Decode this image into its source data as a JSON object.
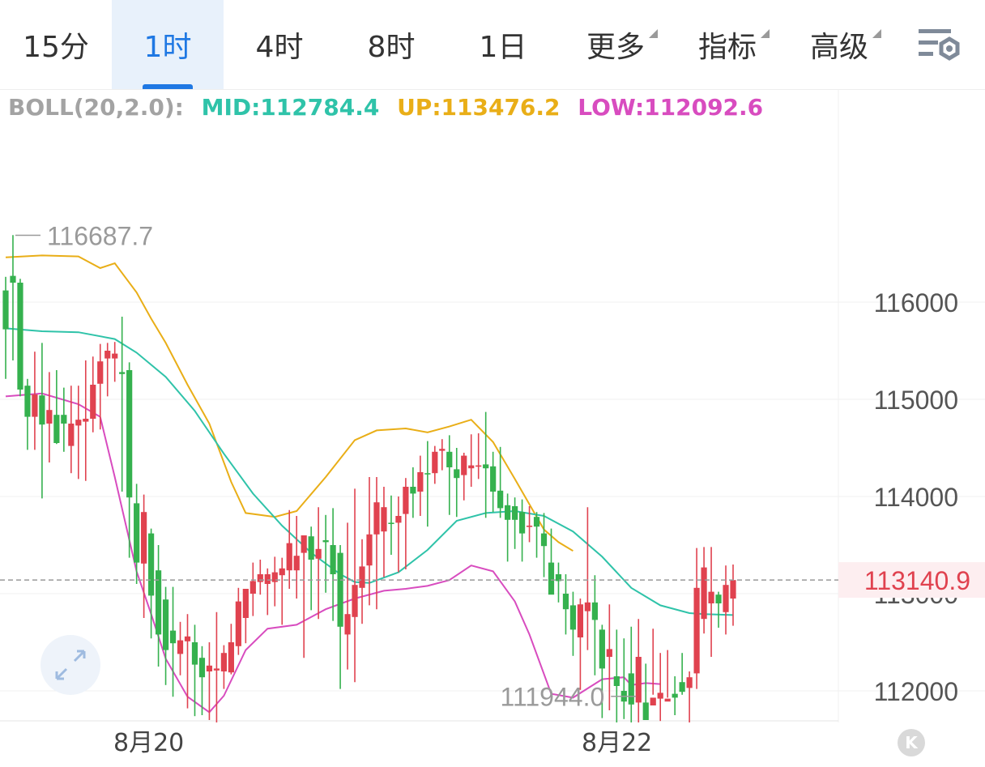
{
  "tabs": [
    {
      "label": "15分",
      "active": false
    },
    {
      "label": "1时",
      "active": true
    },
    {
      "label": "4时",
      "active": false
    },
    {
      "label": "8时",
      "active": false
    },
    {
      "label": "1日",
      "active": false
    },
    {
      "label": "更多",
      "active": false,
      "dropdown": true
    },
    {
      "label": "指标",
      "active": false,
      "dropdown": true
    },
    {
      "label": "高级",
      "active": false,
      "dropdown": true
    }
  ],
  "settings_icon": "chart-settings-icon",
  "expand_icon": "expand-arrows-icon",
  "k_button_label": "K",
  "boll": {
    "name": "BOLL(20,2.0):",
    "mid": "MID:112784.4",
    "up": "UP:113476.2",
    "low": "LOW:112092.6"
  },
  "colors": {
    "up_candle": "#e0424f",
    "down_candle": "#35b14e",
    "mid_line": "#2fc3a9",
    "upper_band": "#e9ae17",
    "lower_band": "#d84cbf",
    "active_tab": "#1f78e3"
  },
  "chart_data": {
    "type": "candlestick",
    "interval": "1时",
    "x_labels": [
      "8月20",
      "8月22"
    ],
    "y_ticks": [
      "116000",
      "115000",
      "114000",
      "113000",
      "112000"
    ],
    "ylim": [
      111650,
      117900
    ],
    "current_price": "113140.9",
    "high_marker": "116687.7",
    "low_marker": "111944.0",
    "candles": [
      [
        116120,
        116260,
        115210,
        115720
      ],
      [
        116270,
        116690,
        115400,
        116200
      ],
      [
        116200,
        116240,
        115030,
        115100
      ],
      [
        115140,
        115210,
        114480,
        114820
      ],
      [
        114820,
        115490,
        114480,
        115050
      ],
      [
        115040,
        115580,
        113980,
        114740
      ],
      [
        114750,
        115280,
        114350,
        114890
      ],
      [
        114840,
        115300,
        114540,
        114550
      ],
      [
        114840,
        115120,
        114460,
        114750
      ],
      [
        114520,
        115140,
        114240,
        114750
      ],
      [
        114730,
        115140,
        114180,
        114790
      ],
      [
        114770,
        115400,
        114160,
        114800
      ],
      [
        114800,
        115440,
        114660,
        115150
      ],
      [
        115160,
        115570,
        114690,
        115390
      ],
      [
        115420,
        115580,
        115030,
        115500
      ],
      [
        115420,
        115590,
        115180,
        115470
      ],
      [
        115280,
        115850,
        114050,
        115260
      ],
      [
        115300,
        115380,
        113370,
        113990
      ],
      [
        113930,
        114130,
        113100,
        113320
      ],
      [
        113310,
        114020,
        112750,
        113840
      ],
      [
        113620,
        113670,
        112540,
        112980
      ],
      [
        113240,
        113500,
        112250,
        112580
      ],
      [
        112940,
        113070,
        112060,
        112420
      ],
      [
        112620,
        113070,
        111940,
        112490
      ],
      [
        112380,
        112710,
        112160,
        112520
      ],
      [
        112510,
        112790,
        111820,
        112560
      ],
      [
        112500,
        112680,
        111740,
        112270
      ],
      [
        112340,
        112460,
        111750,
        112140
      ],
      [
        112200,
        112500,
        111700,
        112260
      ],
      [
        112210,
        112810,
        111560,
        112230
      ],
      [
        112200,
        112470,
        112020,
        112390
      ],
      [
        112190,
        112690,
        112170,
        112500
      ],
      [
        112460,
        113060,
        112370,
        112920
      ],
      [
        112750,
        113040,
        112490,
        113050
      ],
      [
        113000,
        113320,
        112770,
        113130
      ],
      [
        113120,
        113350,
        112990,
        113200
      ],
      [
        113100,
        113260,
        112780,
        113200
      ],
      [
        113120,
        113380,
        112870,
        113220
      ],
      [
        113190,
        113370,
        112680,
        113260
      ],
      [
        113240,
        113860,
        113050,
        113520
      ],
      [
        113240,
        113800,
        112950,
        113390
      ],
      [
        113420,
        113510,
        112340,
        113600
      ],
      [
        113590,
        113690,
        112830,
        113350
      ],
      [
        113360,
        113890,
        112740,
        113460
      ],
      [
        113550,
        113810,
        113010,
        113530
      ],
      [
        113500,
        113880,
        112720,
        113200
      ],
      [
        113420,
        113500,
        112020,
        112660
      ],
      [
        112580,
        113730,
        112220,
        112790
      ],
      [
        112760,
        114080,
        112090,
        113090
      ],
      [
        113060,
        113560,
        112690,
        113280
      ],
      [
        113290,
        114200,
        112880,
        113610
      ],
      [
        113610,
        114200,
        112840,
        113940
      ],
      [
        113640,
        114100,
        113170,
        113890
      ],
      [
        113730,
        114010,
        113400,
        113720
      ],
      [
        113730,
        114000,
        113220,
        113800
      ],
      [
        113820,
        114190,
        113250,
        114100
      ],
      [
        114100,
        114300,
        113780,
        114030
      ],
      [
        114050,
        114420,
        113800,
        114250
      ],
      [
        114240,
        114570,
        113690,
        114230
      ],
      [
        114240,
        114520,
        114130,
        114460
      ],
      [
        114470,
        114590,
        114270,
        114490
      ],
      [
        114460,
        114630,
        113810,
        114300
      ],
      [
        114280,
        114500,
        113790,
        114190
      ],
      [
        114220,
        114450,
        113960,
        114420
      ],
      [
        114290,
        114640,
        114100,
        114320
      ],
      [
        114320,
        114650,
        114180,
        114320
      ],
      [
        114330,
        114870,
        113780,
        114290
      ],
      [
        114310,
        114460,
        113840,
        114050
      ],
      [
        114060,
        114510,
        113780,
        113880
      ],
      [
        113910,
        114030,
        113330,
        113760
      ],
      [
        113900,
        113990,
        113460,
        113760
      ],
      [
        113840,
        113970,
        113330,
        113620
      ],
      [
        113690,
        113900,
        113530,
        113700
      ],
      [
        113790,
        113840,
        113370,
        113690
      ],
      [
        113620,
        113830,
        113170,
        113490
      ],
      [
        113320,
        113670,
        113140,
        112990
      ],
      [
        113200,
        113320,
        112910,
        113130
      ],
      [
        113000,
        113200,
        112580,
        112840
      ],
      [
        112880,
        113020,
        112360,
        112630
      ],
      [
        112550,
        112950,
        112010,
        112890
      ],
      [
        112820,
        113890,
        112420,
        112910
      ],
      [
        112910,
        113190,
        112160,
        112730
      ],
      [
        112630,
        112680,
        111720,
        112230
      ],
      [
        112350,
        112890,
        111800,
        112430
      ],
      [
        112150,
        112630,
        111600,
        112050
      ],
      [
        112000,
        112540,
        111710,
        111890
      ],
      [
        112180,
        112660,
        111540,
        111860
      ],
      [
        111880,
        112740,
        111590,
        112350
      ],
      [
        111880,
        112280,
        111770,
        111700
      ],
      [
        111850,
        112640,
        111960,
        111930
      ],
      [
        111920,
        112390,
        111690,
        111980
      ],
      [
        111890,
        112420,
        111930,
        111920
      ],
      [
        111970,
        112150,
        111750,
        111930
      ],
      [
        112090,
        112390,
        111960,
        111990
      ],
      [
        112030,
        112200,
        111590,
        112140
      ],
      [
        112180,
        113470,
        112020,
        113060
      ],
      [
        112740,
        113480,
        112590,
        113270
      ],
      [
        112900,
        113480,
        112350,
        113020
      ],
      [
        112990,
        113020,
        112650,
        112900
      ],
      [
        112810,
        113290,
        112580,
        113090
      ],
      [
        112950,
        113300,
        112670,
        113140
      ]
    ],
    "mid": [
      [
        0,
        115730
      ],
      [
        5,
        115700
      ],
      [
        10,
        115690
      ],
      [
        15,
        115620
      ],
      [
        18,
        115480
      ],
      [
        22,
        115230
      ],
      [
        26,
        114880
      ],
      [
        30,
        114440
      ],
      [
        34,
        114030
      ],
      [
        38,
        113700
      ],
      [
        42,
        113420
      ],
      [
        46,
        113200
      ],
      [
        48,
        113120
      ],
      [
        50,
        113110
      ],
      [
        54,
        113220
      ],
      [
        58,
        113450
      ],
      [
        62,
        113750
      ],
      [
        66,
        113830
      ],
      [
        70,
        113850
      ],
      [
        74,
        113800
      ],
      [
        78,
        113640
      ],
      [
        82,
        113380
      ],
      [
        86,
        113060
      ],
      [
        90,
        112880
      ],
      [
        94,
        112800
      ],
      [
        96,
        112790
      ],
      [
        100,
        112780
      ]
    ],
    "upper": [
      [
        0,
        116460
      ],
      [
        5,
        116480
      ],
      [
        10,
        116470
      ],
      [
        13,
        116350
      ],
      [
        15,
        116400
      ],
      [
        18,
        116100
      ],
      [
        20,
        115830
      ],
      [
        22,
        115580
      ],
      [
        25,
        115150
      ],
      [
        28,
        114750
      ],
      [
        31,
        114150
      ],
      [
        33,
        113830
      ],
      [
        37,
        113790
      ],
      [
        40,
        113850
      ],
      [
        44,
        114200
      ],
      [
        48,
        114580
      ],
      [
        51,
        114680
      ],
      [
        55,
        114700
      ],
      [
        58,
        114660
      ],
      [
        61,
        114720
      ],
      [
        64,
        114790
      ],
      [
        67,
        114560
      ],
      [
        70,
        114180
      ],
      [
        74,
        113660
      ],
      [
        76,
        113530
      ],
      [
        78,
        113440
      ]
    ],
    "lower": [
      [
        0,
        115030
      ],
      [
        5,
        115060
      ],
      [
        10,
        114950
      ],
      [
        13,
        114820
      ],
      [
        15,
        114200
      ],
      [
        18,
        113230
      ],
      [
        20,
        112790
      ],
      [
        22,
        112330
      ],
      [
        25,
        111940
      ],
      [
        28,
        111780
      ],
      [
        30,
        111950
      ],
      [
        33,
        112420
      ],
      [
        36,
        112640
      ],
      [
        40,
        112680
      ],
      [
        44,
        112840
      ],
      [
        48,
        112950
      ],
      [
        52,
        113030
      ],
      [
        55,
        113050
      ],
      [
        58,
        113080
      ],
      [
        61,
        113140
      ],
      [
        64,
        113290
      ],
      [
        67,
        113230
      ],
      [
        70,
        112920
      ],
      [
        72,
        112580
      ],
      [
        75,
        111970
      ],
      [
        78,
        111930
      ],
      [
        82,
        112120
      ],
      [
        85,
        112140
      ],
      [
        86,
        112060
      ],
      [
        88,
        112080
      ],
      [
        90,
        112070
      ]
    ]
  }
}
